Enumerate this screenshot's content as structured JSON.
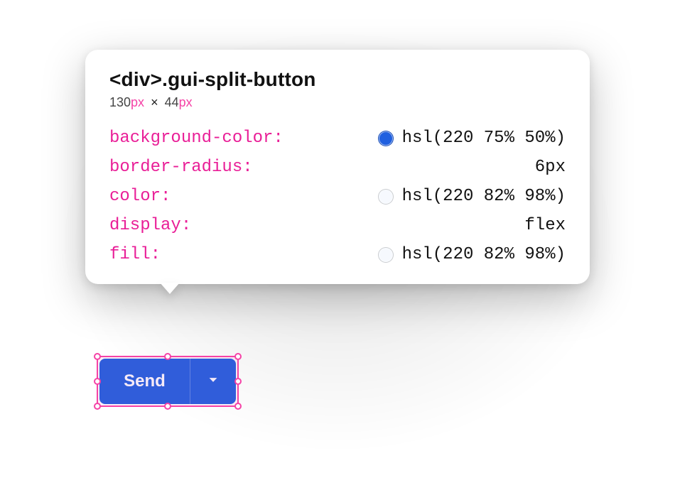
{
  "tooltip": {
    "selector_tag": "<div>",
    "selector_class": ".gui-split-button",
    "dims": {
      "w_num": "130",
      "w_unit": "px",
      "sep": "×",
      "h_num": "44",
      "h_unit": "px"
    },
    "props": [
      {
        "name": "background-color",
        "value": "hsl(220 75% 50%)",
        "swatch": "hsl(220 75% 50%)"
      },
      {
        "name": "border-radius",
        "value": "6px"
      },
      {
        "name": "color",
        "value": "hsl(220 82% 98%)",
        "swatch": "hsl(220 82% 98%)"
      },
      {
        "name": "display",
        "value": "flex"
      },
      {
        "name": "fill",
        "value": "hsl(220 82% 98%)",
        "swatch": "hsl(220 82% 98%)"
      }
    ]
  },
  "button": {
    "label": "Send"
  }
}
